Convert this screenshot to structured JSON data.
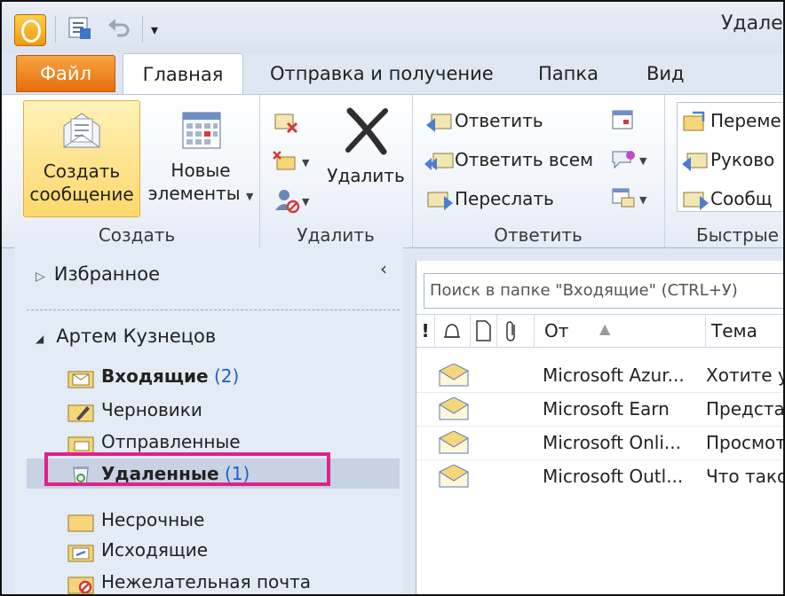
{
  "window": {
    "title": "Удален"
  },
  "tabs": [
    {
      "label": "Файл"
    },
    {
      "label": "Главная"
    },
    {
      "label": "Отправка и получение"
    },
    {
      "label": "Папка"
    },
    {
      "label": "Вид"
    }
  ],
  "ribbon": {
    "create": {
      "new_message_line1": "Создать",
      "new_message_line2": "сообщение",
      "new_items_line1": "Новые",
      "new_items_line2": "элементы",
      "group_label": "Создать"
    },
    "delete": {
      "delete_label": "Удалить",
      "group_label": "Удалить"
    },
    "respond": {
      "reply": "Ответить",
      "reply_all": "Ответить всем",
      "forward": "Переслать",
      "group_label": "Ответить"
    },
    "quick": {
      "item1": "Переме",
      "item2": "Руково",
      "item3": "Сообщ",
      "group_label": "Быстрые д"
    }
  },
  "nav": {
    "favorites": "Избранное",
    "account": "Артем Кузнецов",
    "folders": [
      {
        "name": "Входящие",
        "count": "(2)"
      },
      {
        "name": "Черновики",
        "count": ""
      },
      {
        "name": "Отправленные",
        "count": ""
      },
      {
        "name": "Удаленные",
        "count": "(1)"
      },
      {
        "name": "Несрочные",
        "count": ""
      },
      {
        "name": "Исходящие",
        "count": ""
      },
      {
        "name": "Нежелательная почта",
        "count": ""
      }
    ]
  },
  "search": {
    "placeholder": "Поиск в папке \"Входящие\" (CTRL+У)"
  },
  "columns": {
    "importance": "!",
    "from": "От",
    "subject": "Тема"
  },
  "messages": [
    {
      "from": "Microsoft Azur...",
      "subject": "Хотите у"
    },
    {
      "from": "Microsoft Earn",
      "subject": "Предста"
    },
    {
      "from": "Microsoft Onli...",
      "subject": "Просмот"
    },
    {
      "from": "Microsoft Outl...",
      "subject": "Что тако"
    }
  ],
  "colors": {
    "file_tab": "#e66e0c",
    "highlight": "#e0218a",
    "count": "#1f5fc8"
  }
}
